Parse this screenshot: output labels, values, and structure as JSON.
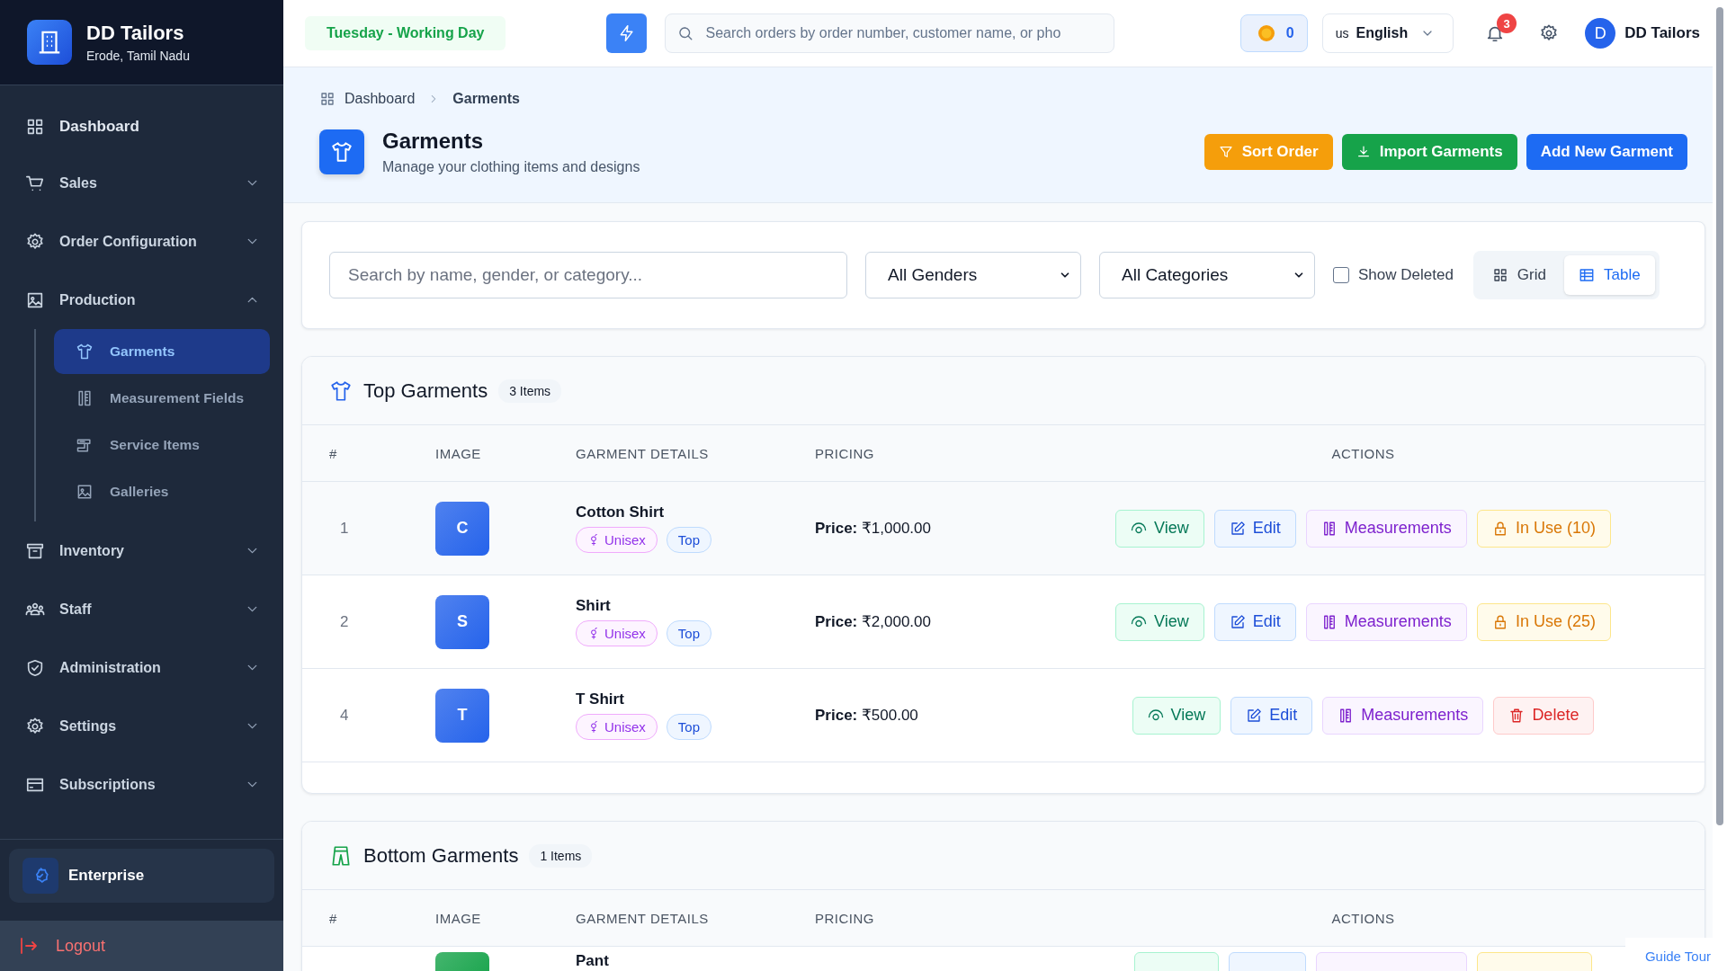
{
  "brand": {
    "name": "DD Tailors",
    "location": "Erode, Tamil Nadu"
  },
  "sidebar": {
    "items": [
      {
        "label": "Dashboard",
        "kind": "link"
      },
      {
        "label": "Sales",
        "kind": "group",
        "expanded": false
      },
      {
        "label": "Order Configuration",
        "kind": "group",
        "expanded": false
      },
      {
        "label": "Production",
        "kind": "group",
        "expanded": true,
        "children": [
          {
            "label": "Garments",
            "selected": true
          },
          {
            "label": "Measurement Fields",
            "selected": false
          },
          {
            "label": "Service Items",
            "selected": false
          },
          {
            "label": "Galleries",
            "selected": false
          }
        ]
      },
      {
        "label": "Inventory",
        "kind": "group",
        "expanded": false
      },
      {
        "label": "Staff",
        "kind": "group",
        "expanded": false
      },
      {
        "label": "Administration",
        "kind": "group",
        "expanded": false
      },
      {
        "label": "Settings",
        "kind": "group",
        "expanded": false
      },
      {
        "label": "Subscriptions",
        "kind": "group",
        "expanded": false
      }
    ],
    "plan": "Enterprise",
    "logout": "Logout"
  },
  "topbar": {
    "day_status": "Tuesday - Working Day",
    "search": {
      "placeholder": "Search orders by order number, customer name, or pho"
    },
    "coins": "0",
    "language": {
      "code": "us",
      "name": "English"
    },
    "notifications": "3",
    "user": {
      "initial": "D",
      "name": "DD Tailors"
    }
  },
  "breadcrumb": [
    "Dashboard",
    "Garments"
  ],
  "page": {
    "title": "Garments",
    "subtitle": "Manage your clothing items and designs",
    "buttons": [
      {
        "label": "Sort Order",
        "kind": "sort"
      },
      {
        "label": "Import Garments",
        "kind": "import"
      },
      {
        "label": "Add New Garment",
        "kind": "add"
      }
    ]
  },
  "filters": {
    "search": {
      "placeholder": "Search by name, gender, or category..."
    },
    "gender": "All Genders",
    "category": "All Categories",
    "show_deleted": {
      "label": "Show Deleted",
      "checked": false
    },
    "views": [
      {
        "label": "Grid",
        "selected": false
      },
      {
        "label": "Table",
        "selected": true
      }
    ]
  },
  "sections": [
    {
      "title": "Top Garments",
      "kind": "top",
      "count": "3 Items",
      "color": "#2563eb",
      "columns": [
        "#",
        "IMAGE",
        "GARMENT DETAILS",
        "PRICING",
        "ACTIONS"
      ],
      "rows": [
        {
          "index": "1",
          "initial": "C",
          "name": "Cotton Shirt",
          "gender": "Unisex",
          "category": "Top",
          "price_label": "Price:",
          "price": "₹1,000.00",
          "highlighted": true,
          "actions": [
            {
              "kind": "view",
              "label": "View"
            },
            {
              "kind": "edit",
              "label": "Edit"
            },
            {
              "kind": "measure",
              "label": "Measurements"
            },
            {
              "kind": "inuse",
              "label": "In Use (10)"
            }
          ]
        },
        {
          "index": "2",
          "initial": "S",
          "name": "Shirt",
          "gender": "Unisex",
          "category": "Top",
          "price_label": "Price:",
          "price": "₹2,000.00",
          "highlighted": false,
          "actions": [
            {
              "kind": "view",
              "label": "View"
            },
            {
              "kind": "edit",
              "label": "Edit"
            },
            {
              "kind": "measure",
              "label": "Measurements"
            },
            {
              "kind": "inuse",
              "label": "In Use (25)"
            }
          ]
        },
        {
          "index": "4",
          "initial": "T",
          "name": "T Shirt",
          "gender": "Unisex",
          "category": "Top",
          "price_label": "Price:",
          "price": "₹500.00",
          "highlighted": false,
          "actions": [
            {
              "kind": "view",
              "label": "View"
            },
            {
              "kind": "edit",
              "label": "Edit"
            },
            {
              "kind": "measure",
              "label": "Measurements"
            },
            {
              "kind": "delete",
              "label": "Delete"
            }
          ]
        }
      ]
    },
    {
      "title": "Bottom Garments",
      "kind": "bottom",
      "count": "1 Items",
      "color": "#16a34a",
      "columns": [
        "#",
        "IMAGE",
        "GARMENT DETAILS",
        "PRICING",
        "ACTIONS"
      ],
      "rows": [
        {
          "name": "Pant",
          "actions": [
            {
              "kind": "view"
            },
            {
              "kind": "edit"
            },
            {
              "kind": "measure"
            },
            {
              "kind": "inuse"
            }
          ]
        }
      ]
    }
  ],
  "guide_tour": "Guide Tour"
}
